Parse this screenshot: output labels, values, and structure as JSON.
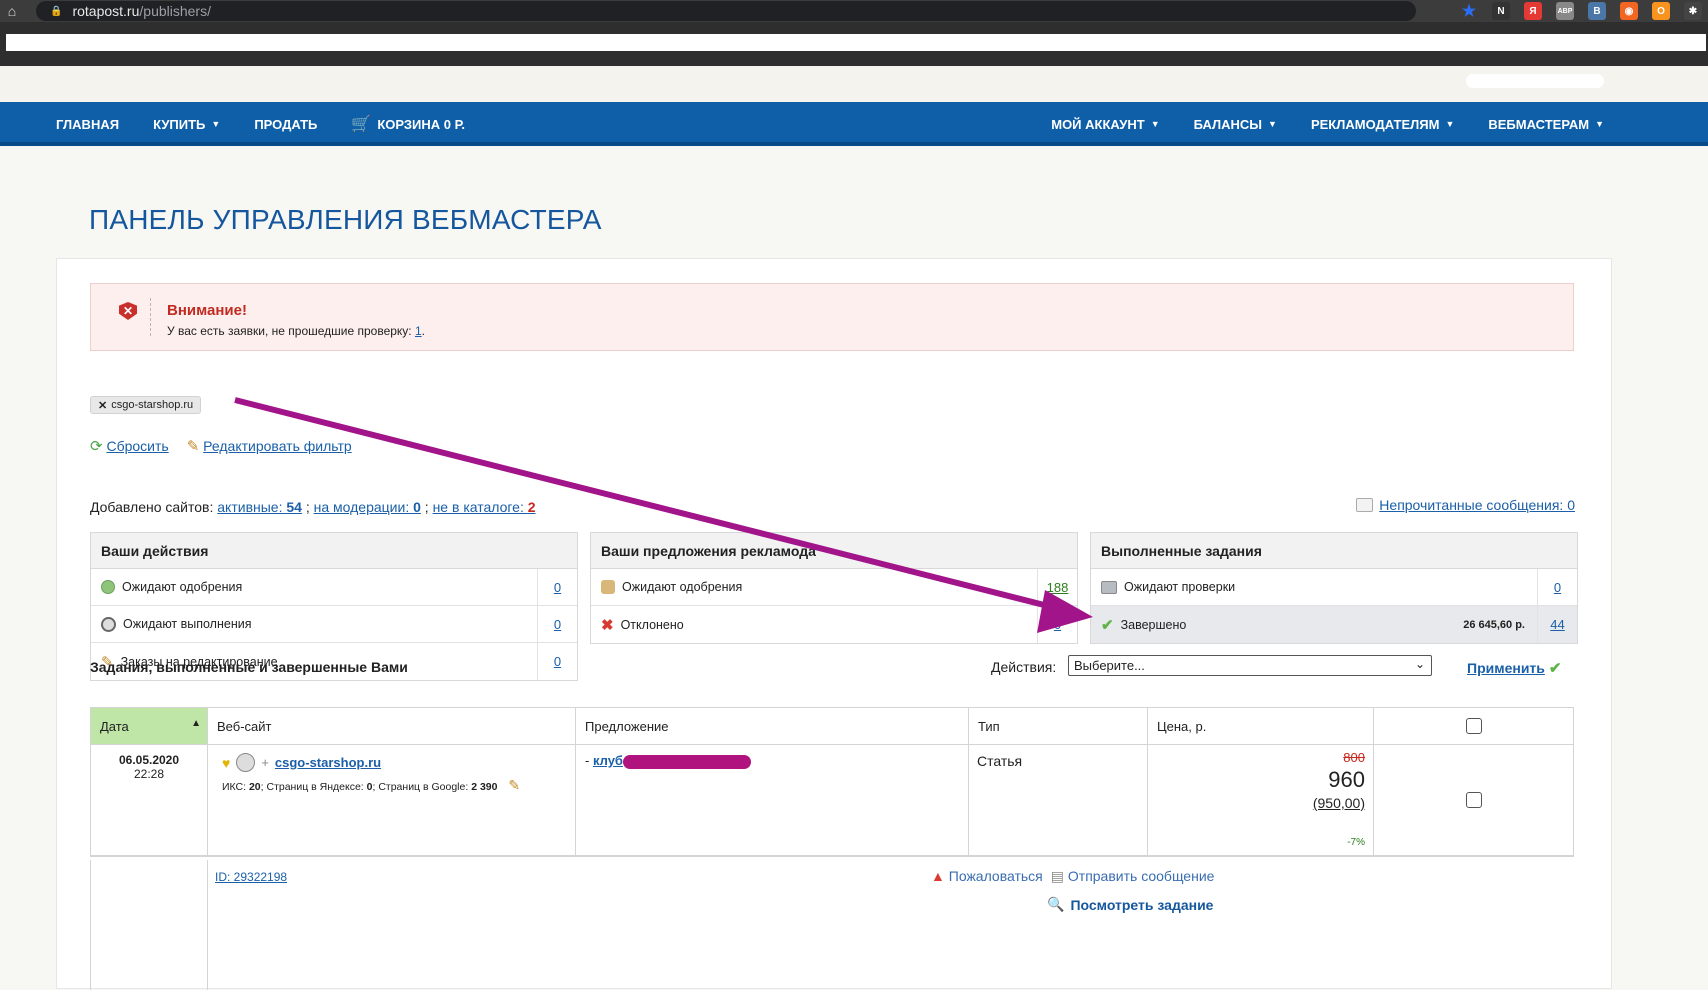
{
  "browser": {
    "url_host": "rotapost.ru",
    "url_path": "/publishers/",
    "extensions": [
      {
        "name": "bookmark-star-icon",
        "color": "#2a6df4",
        "glyph": "★"
      },
      {
        "name": "ext-notion-icon",
        "color": "#333333",
        "glyph": "N"
      },
      {
        "name": "ext-yandex-icon",
        "color": "#e53935",
        "glyph": "Я"
      },
      {
        "name": "ext-abp-icon",
        "color": "#888888",
        "glyph": "ABP"
      },
      {
        "name": "ext-vk-icon",
        "color": "#4a76a8",
        "glyph": "B"
      },
      {
        "name": "ext-rss-icon",
        "color": "#f26522",
        "glyph": "◉"
      },
      {
        "name": "ext-ok-icon",
        "color": "#f7931e",
        "glyph": "O"
      },
      {
        "name": "extensions-puzzle-icon",
        "color": "#444444",
        "glyph": "✱"
      }
    ]
  },
  "nav": {
    "home": "ГЛАВНАЯ",
    "buy": "КУПИТЬ",
    "sell": "ПРОДАТЬ",
    "cart": "КОРЗИНА 0 Р.",
    "account": "МОЙ АККАУНТ",
    "balances": "БАЛАНСЫ",
    "advertisers": "РЕКЛАМОДАТЕЛЯМ",
    "webmasters": "ВЕБМАСТЕРАМ"
  },
  "page_title": "ПАНЕЛЬ УПРАВЛЕНИЯ ВЕБМАСТЕРА",
  "alert": {
    "title": "Внимание!",
    "text": "У вас есть заявки, не прошедшие проверку: ",
    "link": "1",
    "suffix": "."
  },
  "filter": {
    "tag": "csgo-starshop.ru",
    "reset": "Сбросить",
    "edit": "Редактировать фильтр"
  },
  "sites": {
    "prefix": "Добавлено сайтов: ",
    "active_label": "активные: ",
    "active_count": "54",
    "moderation_label": "на модерации: ",
    "moderation_count": "0",
    "not_in_catalog_label": "не в каталоге: ",
    "not_in_catalog_count": "2",
    "sep": " ; "
  },
  "unread_messages": "Непрочитанные сообщения: 0",
  "boxes": {
    "actions": {
      "title": "Ваши действия",
      "rows": [
        {
          "label": "Ожидают одобрения",
          "count": "0"
        },
        {
          "label": "Ожидают выполнения",
          "count": "0"
        },
        {
          "label": "Заказы на редактирование",
          "count": "0"
        }
      ]
    },
    "offers": {
      "title": "Ваши предложения рекламода",
      "rows": [
        {
          "label": "Ожидают одобрения",
          "count": "188"
        },
        {
          "label": "Отклонено",
          "count": "0"
        }
      ]
    },
    "done": {
      "title": "Выполненные задания",
      "rows": [
        {
          "label": "Ожидают проверки",
          "count": "0",
          "sum": ""
        },
        {
          "label": "Завершено",
          "count": "44",
          "sum": "26 645,60 р."
        }
      ]
    }
  },
  "tasks": {
    "title": "Задания, выполненные и завершенные Вами",
    "actions_label": "Действия:",
    "select_value": "Выберите...",
    "apply": "Применить",
    "columns": [
      "Дата",
      "Веб-сайт",
      "Предложение",
      "Тип",
      "Цена, р."
    ],
    "rows": [
      {
        "date": "06.05.2020",
        "time": "22:28",
        "site_plus": "+",
        "site": "csgo-starshop.ru",
        "iks_label": "ИКС: ",
        "iks": "20",
        "yandex_label": "; Страниц в Яндексе: ",
        "yandex": "0",
        "google_label": "; Страниц в Google: ",
        "google": "2 390",
        "offer_prefix": "- ",
        "offer": "клуб",
        "type": "Статья",
        "price_old": "800",
        "price_new": "960",
        "price_base": "(950,00)",
        "discount": "-7%",
        "id": "ID: 29322198",
        "complain": "Пожаловаться",
        "send_message": "Отправить сообщение",
        "view_task": "Посмотреть задание"
      }
    ]
  },
  "annotation": {
    "arrow_color": "#a21489"
  }
}
